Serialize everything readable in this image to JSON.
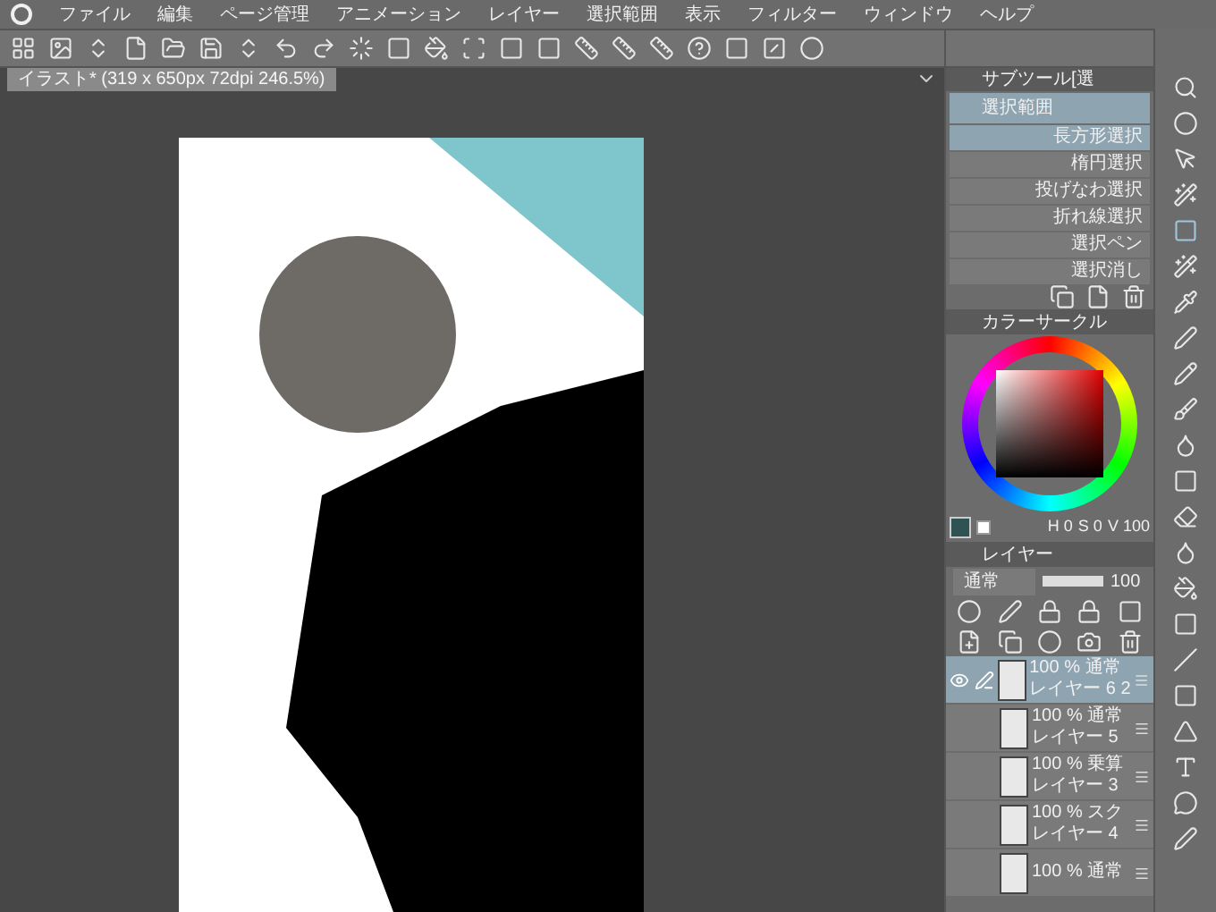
{
  "menu": [
    "ファイル",
    "編集",
    "ページ管理",
    "アニメーション",
    "レイヤー",
    "選択範囲",
    "表示",
    "フィルター",
    "ウィンドウ",
    "ヘルプ"
  ],
  "document_tab": {
    "title": "イラスト* (319 x 650px 72dpi 246.5%)"
  },
  "sub_tool": {
    "tab": "サブツール[選",
    "group": "選択範囲",
    "items": [
      {
        "label": "長方形選択",
        "selected": true
      },
      {
        "label": "楕円選択",
        "selected": false
      },
      {
        "label": "投げなわ選択",
        "selected": false
      },
      {
        "label": "折れ線選択",
        "selected": false
      },
      {
        "label": "選択ペン",
        "selected": false
      },
      {
        "label": "選択消し",
        "selected": false
      }
    ]
  },
  "color": {
    "tab": "カラーサークル",
    "h_label": "H",
    "h": "0",
    "s_label": "S",
    "s": "0",
    "v_label": "V",
    "v": "100"
  },
  "layers": {
    "tab": "レイヤー",
    "blend": "通常",
    "opacity": "100",
    "opacity_slider": {
      "level": 1.0
    },
    "items": [
      {
        "mode": "100 % 通常",
        "name": "レイヤー 6 2",
        "selected": true,
        "visible": true,
        "editing": true
      },
      {
        "mode": "100 % 通常",
        "name": "レイヤー 5",
        "selected": false,
        "visible": false,
        "editing": false
      },
      {
        "mode": "100 % 乗算",
        "name": "レイヤー 3",
        "selected": false,
        "visible": false,
        "editing": false
      },
      {
        "mode": "100 % スク",
        "name": "レイヤー 4",
        "selected": false,
        "visible": false,
        "editing": false
      },
      {
        "mode": "100 % 通常",
        "selected": false,
        "visible": false,
        "editing": false
      }
    ]
  }
}
